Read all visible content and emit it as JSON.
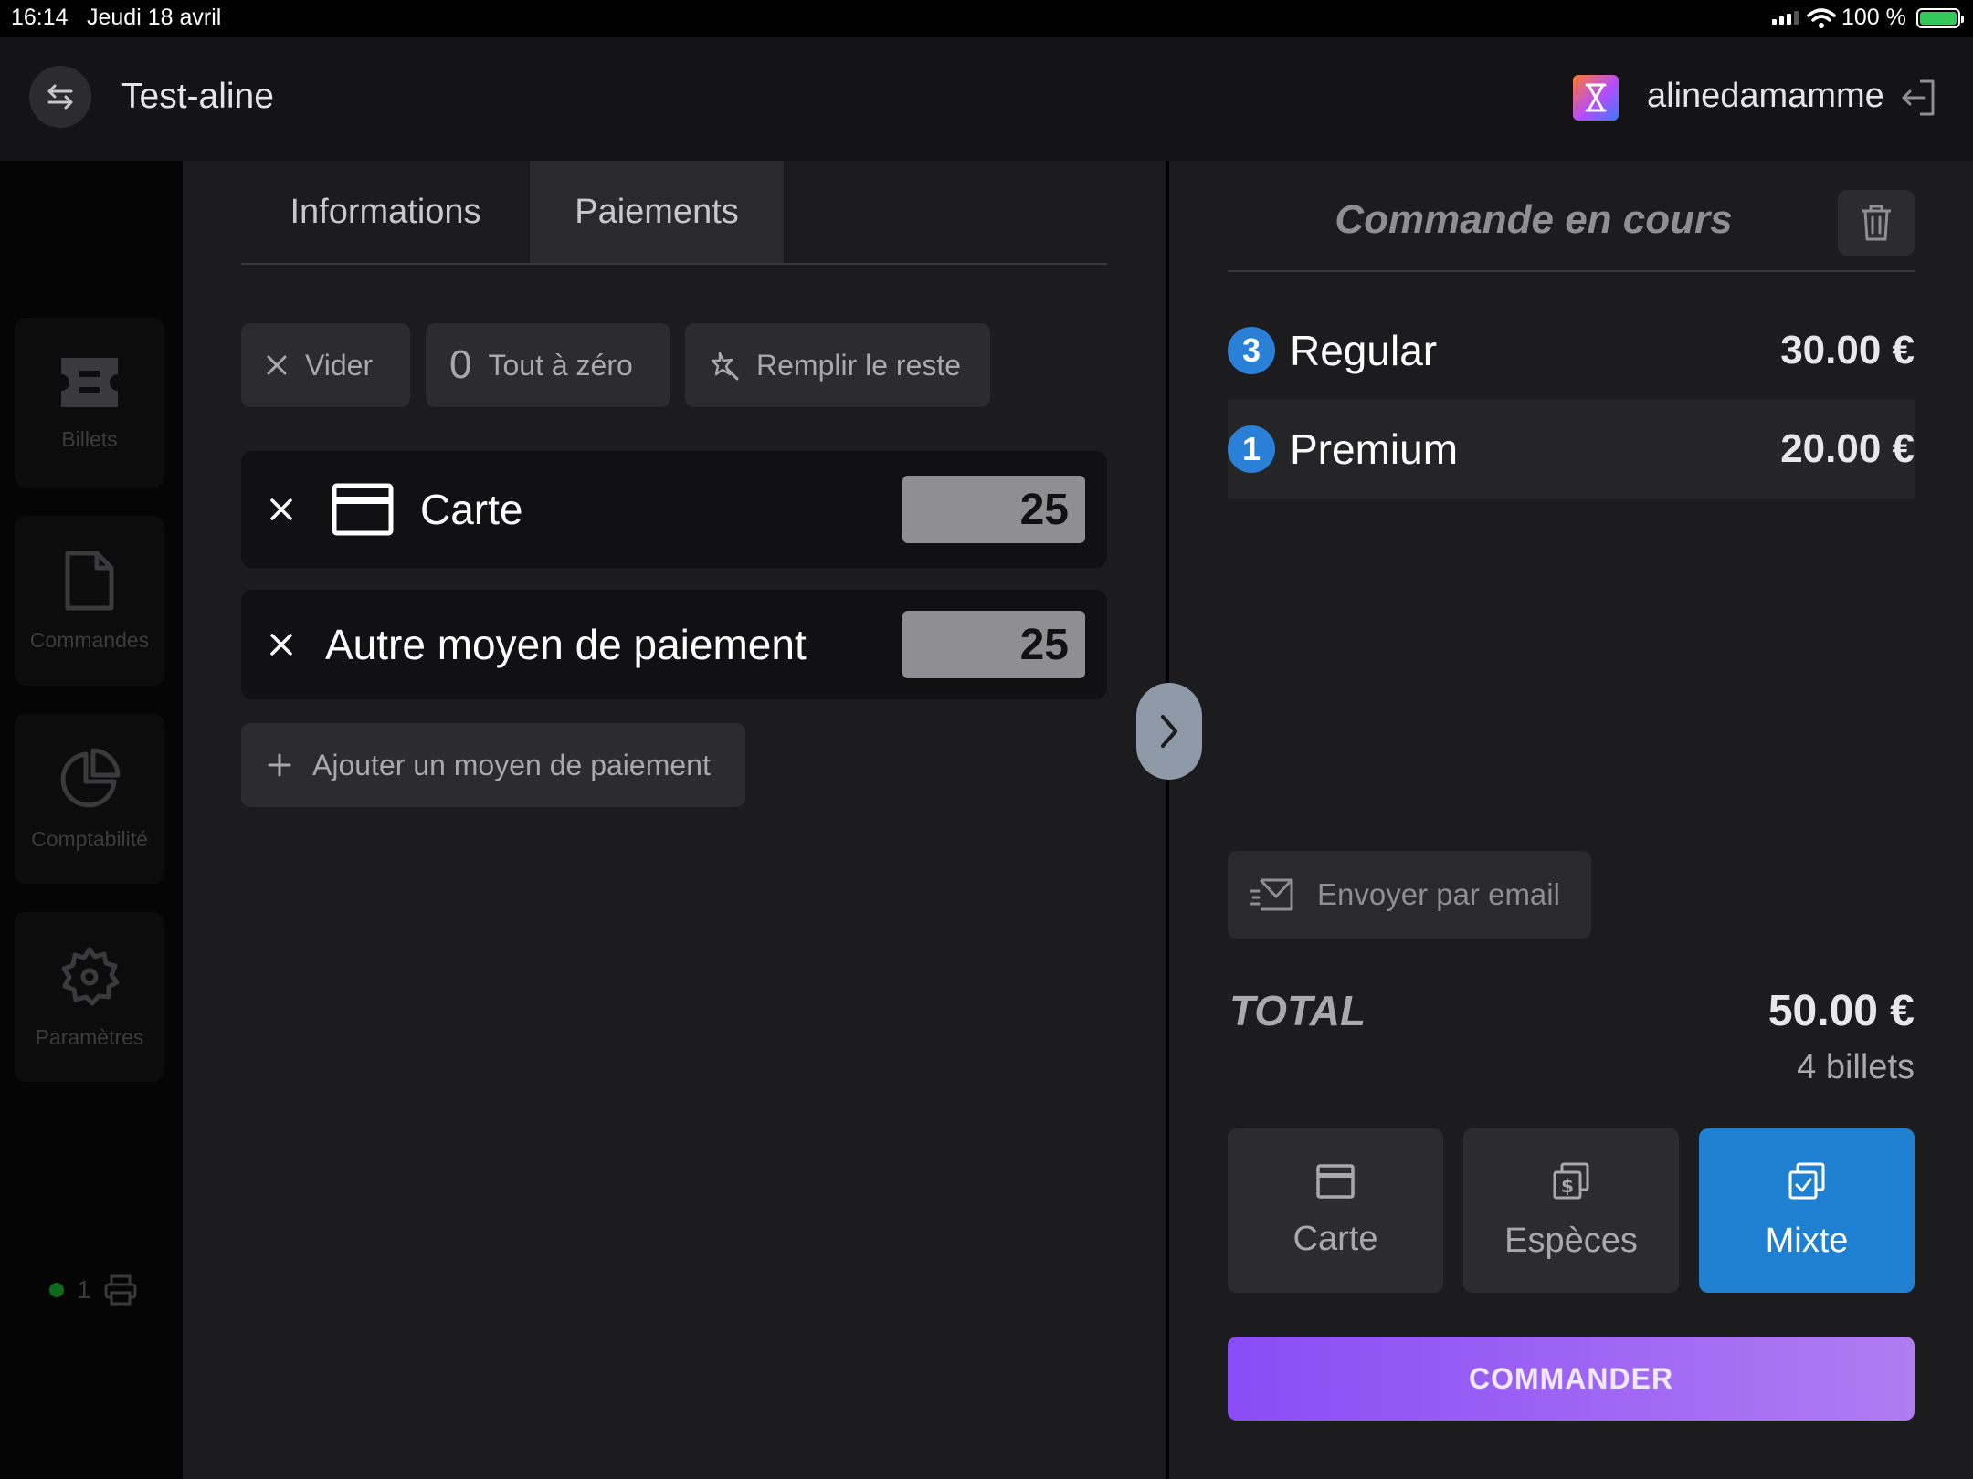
{
  "status_bar": {
    "time": "16:14",
    "date": "Jeudi 18 avril",
    "battery": "100 %"
  },
  "header": {
    "title": "Test-aline",
    "username": "alinedamamme",
    "icons": {
      "back": "swap-arrows-icon",
      "logout": "logout-icon"
    }
  },
  "sidebar": {
    "items": [
      {
        "label": "Billets",
        "icon": "ticket-icon"
      },
      {
        "label": "Commandes",
        "icon": "document-icon"
      },
      {
        "label": "Comptabilité",
        "icon": "pie-chart-icon"
      },
      {
        "label": "Paramètres",
        "icon": "gear-icon"
      }
    ],
    "printer_count": "1"
  },
  "tabs": [
    {
      "label": "Informations",
      "active": false
    },
    {
      "label": "Paiements",
      "active": true
    }
  ],
  "actions": {
    "clear": "Vider",
    "reset_zero": "Tout à zéro",
    "fill_rest": "Remplir le reste",
    "zero_glyph": "0"
  },
  "payments": [
    {
      "label": "Carte",
      "amount": "25"
    },
    {
      "label": "Autre moyen de paiement",
      "amount": "25"
    }
  ],
  "add_payment": "Ajouter un moyen de paiement",
  "order": {
    "title": "Commande en cours",
    "items": [
      {
        "qty": "3",
        "name": "Regular",
        "price": "30.00 €"
      },
      {
        "qty": "1",
        "name": "Premium",
        "price": "20.00 €"
      }
    ],
    "send_email": "Envoyer par email",
    "total_label": "TOTAL",
    "total_value": "50.00 €",
    "ticket_count": "4 billets",
    "methods": [
      {
        "label": "Carte",
        "icon": "card-icon",
        "active": false
      },
      {
        "label": "Espèces",
        "icon": "cash-icon",
        "active": false
      },
      {
        "label": "Mixte",
        "icon": "mixed-icon",
        "active": true
      }
    ],
    "submit": "COMMANDER"
  },
  "colors": {
    "accent_blue": "#1f7fd1",
    "submit_gradient_start": "#8a4cf5",
    "submit_gradient_end": "#b07cf2",
    "status_green": "#34c759"
  }
}
